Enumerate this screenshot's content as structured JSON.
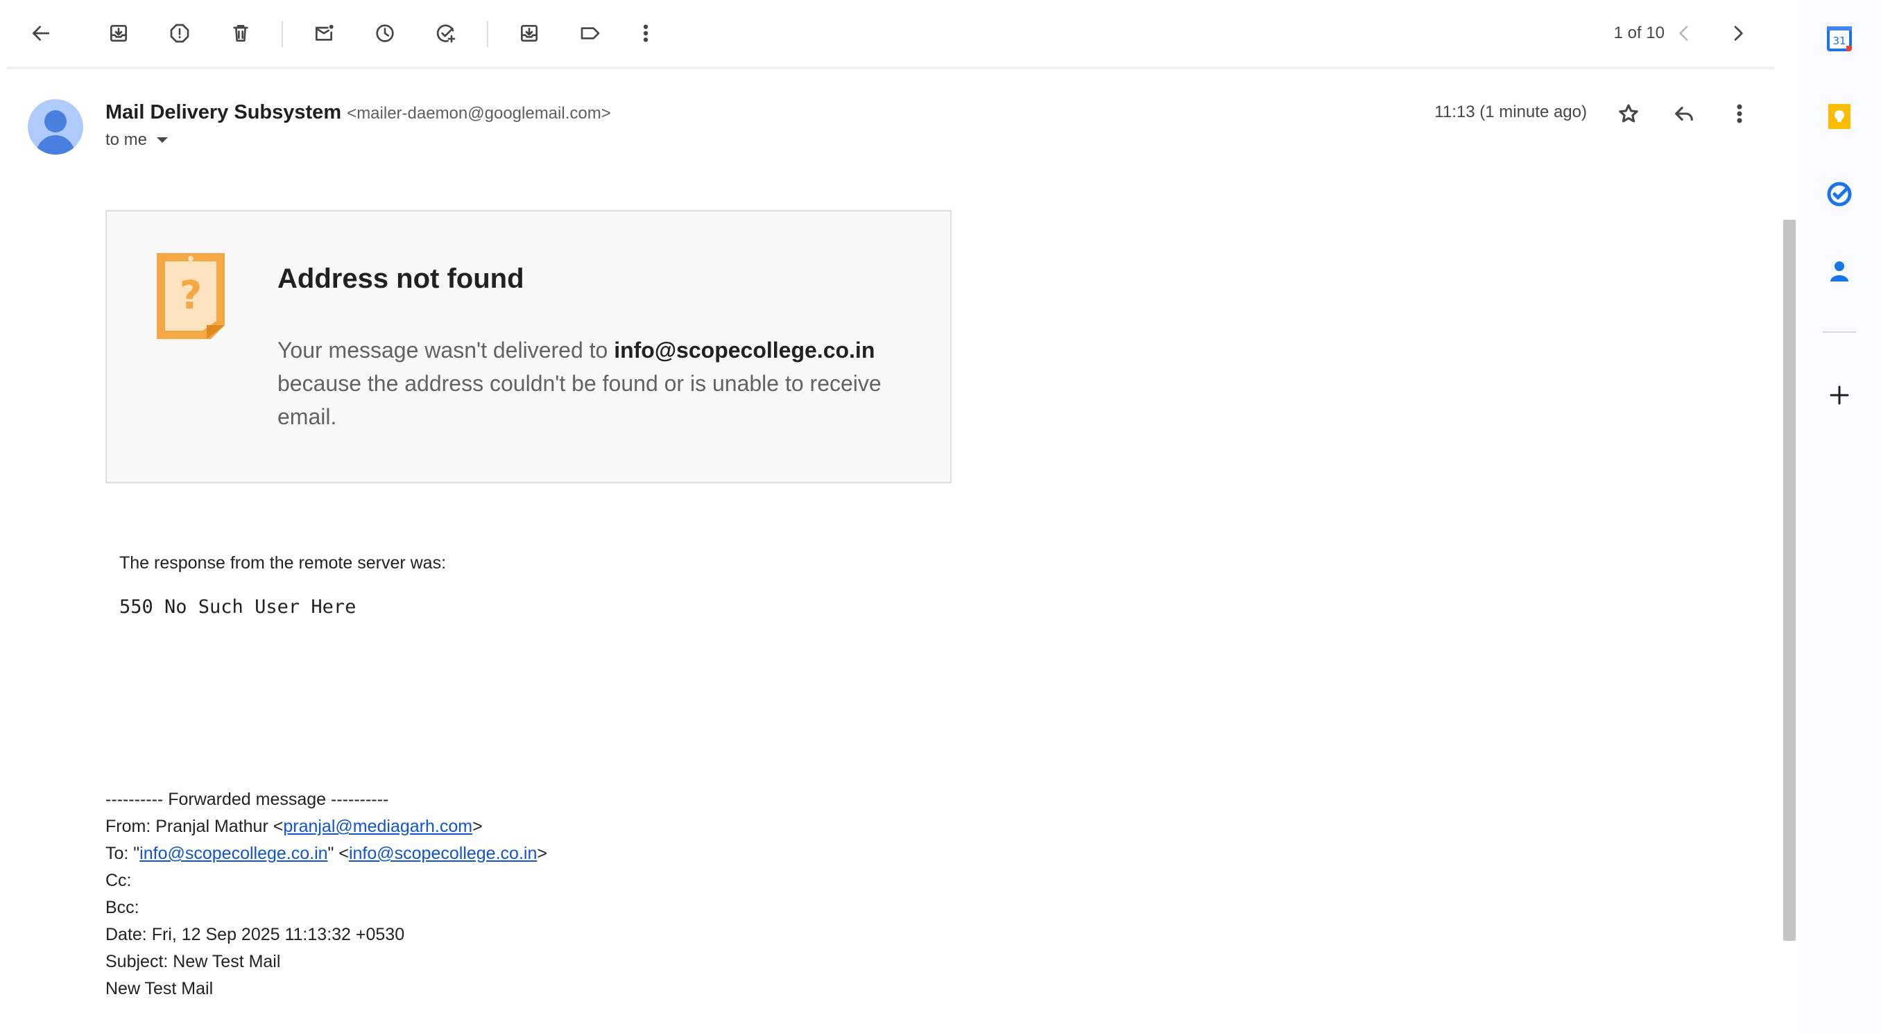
{
  "toolbar": {
    "pager_text": "1 of 10"
  },
  "message": {
    "sender_name": "Mail Delivery Subsystem",
    "sender_address": "<mailer-daemon@googlemail.com>",
    "recipient_label": "to me",
    "time": "11:13 (1 minute ago)"
  },
  "card": {
    "title": "Address not found",
    "text_before": "Your message wasn't delivered to ",
    "address": "info@scopecollege.co.in",
    "text_after": " because the address couldn't be found or is unable to receive email."
  },
  "body": {
    "response_label": "The response from the remote server was:",
    "response_code": "550 No Such User Here"
  },
  "forwarded": {
    "divider": "---------- Forwarded message ----------",
    "from_prefix": "From: Pranjal Mathur <",
    "from_email": "pranjal@mediagarh.com",
    "from_suffix": ">",
    "to_prefix": "To: \"",
    "to_email_1": "info@scopecollege.co.in",
    "to_middle": "\" <",
    "to_email_2": "info@scopecollege.co.in",
    "to_suffix": ">",
    "cc": "Cc:",
    "bcc": "Bcc:",
    "date": "Date: Fri, 12 Sep 2025 11:13:32 +0530",
    "subject": "Subject: New Test Mail",
    "body": "New Test Mail"
  },
  "side_panel": {
    "calendar_day": "31"
  },
  "icons": {
    "toolbar": [
      "back-arrow-icon",
      "archive-icon",
      "report-spam-icon",
      "delete-icon",
      "mark-unread-icon",
      "snooze-icon",
      "add-to-tasks-icon",
      "move-to-icon",
      "label-icon",
      "more-vert-icon",
      "chevron-left-icon",
      "chevron-right-icon"
    ],
    "header": [
      "star-icon",
      "reply-icon",
      "more-vert-icon"
    ],
    "side": [
      "calendar-icon",
      "keep-icon",
      "tasks-icon",
      "contacts-icon",
      "plus-icon"
    ]
  },
  "colors": {
    "link": "#1155cc",
    "avatar_bg": "#aecbfa",
    "avatar_fg": "#4a7fe0",
    "note_orange": "#f4a742",
    "keep_yellow": "#fbbc04",
    "tasks_blue": "#1a73e8"
  }
}
